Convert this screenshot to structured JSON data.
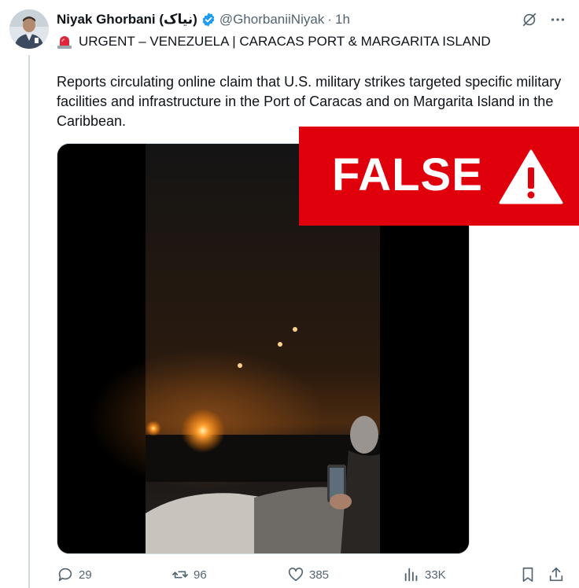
{
  "post": {
    "display_name": "Niyak Ghorbani (نیاک)",
    "handle": "@GhorbaniiNiyak",
    "separator": "·",
    "time": "1h",
    "headline": "URGENT – VENEZUELA | CARACAS PORT & MARGARITA ISLAND",
    "body": "Reports circulating online claim that U.S. military strikes targeted specific military facilities and infrastructure in the Port of Caracas and on Margarita Island in the Caribbean."
  },
  "overlay": {
    "label": "FALSE",
    "color": "#e0000c"
  },
  "actions": {
    "replies": "29",
    "reposts": "96",
    "likes": "385",
    "views": "33K"
  },
  "icons": {
    "verified": "verified-badge-icon",
    "siren": "siren-emoji-icon",
    "grok": "grok-icon",
    "more": "more-icon",
    "reply": "reply-icon",
    "repost": "repost-icon",
    "like": "heart-icon",
    "views": "views-icon",
    "bookmark": "bookmark-icon",
    "share": "share-icon"
  }
}
